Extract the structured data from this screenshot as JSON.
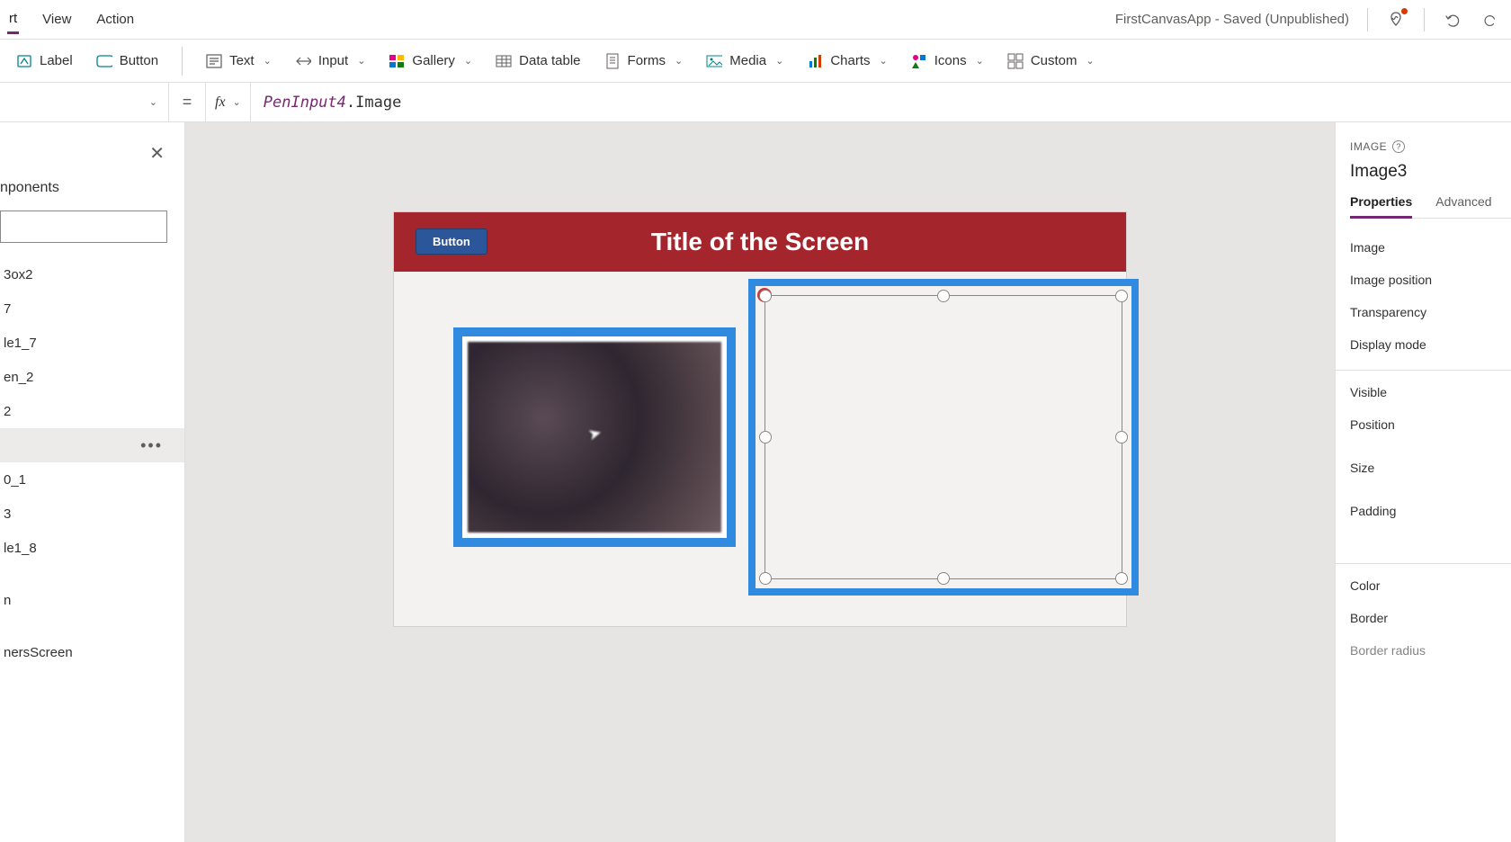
{
  "menubar": {
    "items": [
      "rt",
      "View",
      "Action"
    ],
    "app_title": "FirstCanvasApp - Saved (Unpublished)"
  },
  "ribbon": {
    "label": "Label",
    "button": "Button",
    "text": "Text",
    "input": "Input",
    "gallery": "Gallery",
    "data_table": "Data table",
    "forms": "Forms",
    "media": "Media",
    "charts": "Charts",
    "icons": "Icons",
    "custom": "Custom"
  },
  "formula": {
    "equals": "=",
    "fx": "fx",
    "object": "PenInput4",
    "property": ".Image"
  },
  "tree": {
    "header": "nponents",
    "items": [
      "3ox2",
      "7",
      "le1_7",
      "en_2",
      "2",
      "",
      "0_1",
      "3",
      "le1_8",
      "n",
      "nersScreen"
    ],
    "selected_index": 5
  },
  "canvas": {
    "screen_title": "Title of the Screen",
    "header_button": "Button"
  },
  "props": {
    "type_label": "IMAGE",
    "control_name": "Image3",
    "tabs": {
      "properties": "Properties",
      "advanced": "Advanced"
    },
    "group1": [
      "Image",
      "Image position",
      "Transparency",
      "Display mode"
    ],
    "group2": [
      "Visible",
      "Position",
      "Size",
      "Padding"
    ],
    "group3": [
      "Color",
      "Border",
      "Border radius"
    ]
  }
}
